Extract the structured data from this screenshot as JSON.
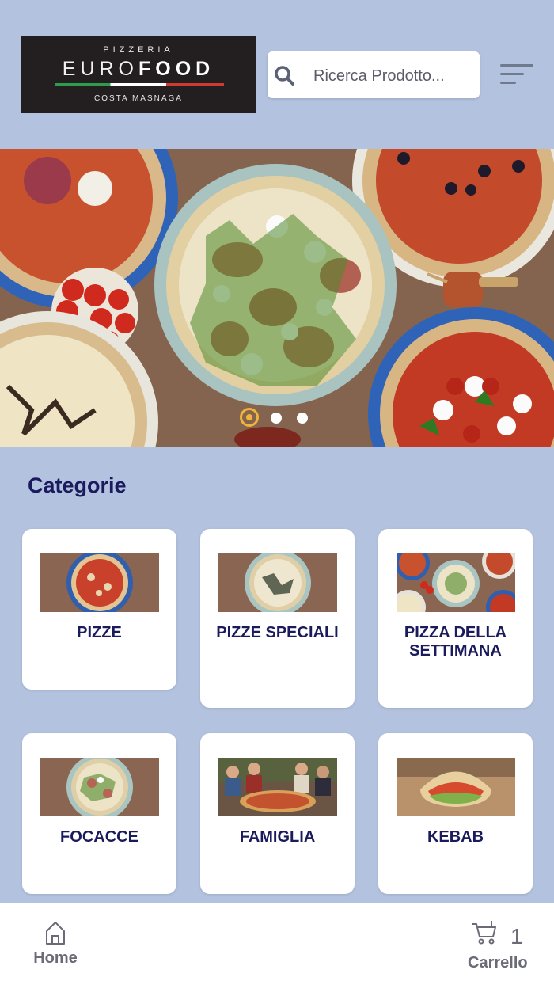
{
  "header": {
    "logo": {
      "line1": "PIZZERIA",
      "brand_light": "EURO",
      "brand_bold": "FOOD",
      "line3": "COSTA MASNAGA"
    },
    "search": {
      "placeholder": "Ricerca Prodotto..."
    },
    "menu_icon": "hamburger-menu-icon"
  },
  "carousel": {
    "slide_count": 3,
    "active_index": 0,
    "active_dot_color": "#f0b43a"
  },
  "categories": {
    "title": "Categorie",
    "items": [
      {
        "label": "PIZZE"
      },
      {
        "label": "PIZZE SPECIALI"
      },
      {
        "label": "PIZZA DELLA SETTIMANA"
      },
      {
        "label": "FOCACCE"
      },
      {
        "label": "FAMIGLIA"
      },
      {
        "label": "KEBAB"
      }
    ]
  },
  "bottom_nav": {
    "home": {
      "label": "Home",
      "icon": "home-icon"
    },
    "cart": {
      "label": "Carrello",
      "count": "1",
      "icon": "cart-icon"
    }
  },
  "colors": {
    "background": "#b3c2df",
    "accent_text": "#1a1a5c",
    "nav_text": "#6b6b78"
  }
}
